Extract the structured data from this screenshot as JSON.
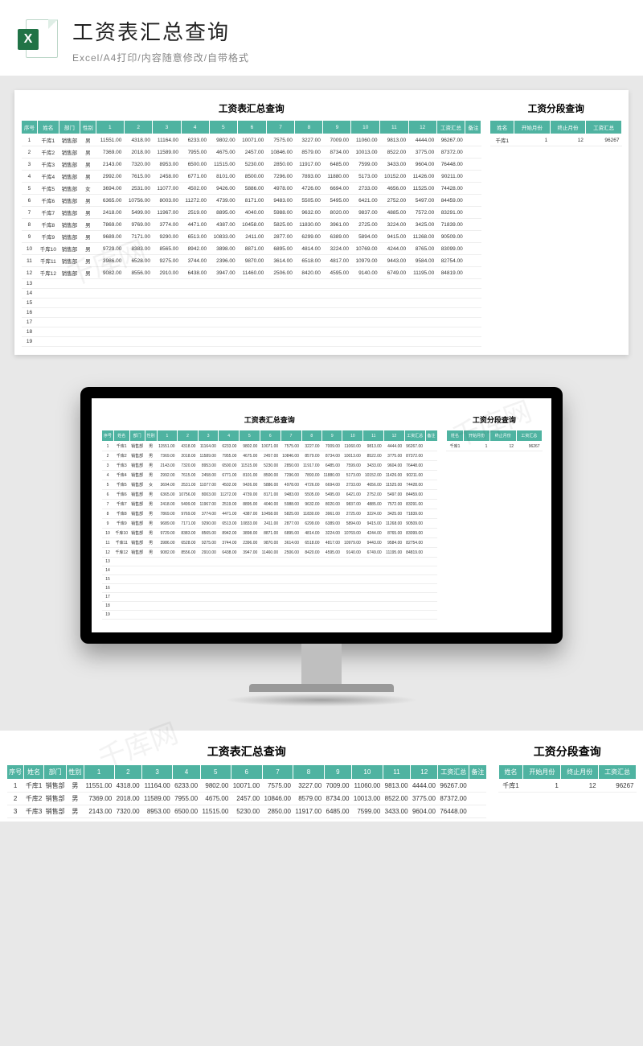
{
  "header": {
    "title": "工资表汇总查询",
    "subtitle": "Excel/A4打印/内容随意修改/自带格式",
    "icon_label": "X"
  },
  "main_table": {
    "title": "工资表汇总查询",
    "headers": [
      "序号",
      "姓名",
      "部门",
      "性别",
      "1",
      "2",
      "3",
      "4",
      "5",
      "6",
      "7",
      "8",
      "9",
      "10",
      "11",
      "12",
      "工资汇总",
      "备注"
    ],
    "rows": [
      [
        "1",
        "千库1",
        "销售部",
        "男",
        "11551.00",
        "4318.00",
        "11164.00",
        "6233.00",
        "9802.00",
        "10071.00",
        "7575.00",
        "3227.00",
        "7009.00",
        "11060.00",
        "9813.00",
        "4444.00",
        "96267.00",
        ""
      ],
      [
        "2",
        "千库2",
        "销售部",
        "男",
        "7369.00",
        "2018.00",
        "11589.00",
        "7955.00",
        "4675.00",
        "2457.00",
        "10846.00",
        "8579.00",
        "8734.00",
        "10013.00",
        "8522.00",
        "3775.00",
        "87372.00",
        ""
      ],
      [
        "3",
        "千库3",
        "销售部",
        "男",
        "2143.00",
        "7320.00",
        "8953.00",
        "6500.00",
        "11515.00",
        "5230.00",
        "2850.00",
        "11917.00",
        "6485.00",
        "7599.00",
        "3433.00",
        "9604.00",
        "76448.00",
        ""
      ],
      [
        "4",
        "千库4",
        "销售部",
        "男",
        "2992.00",
        "7615.00",
        "2458.00",
        "6771.00",
        "8101.00",
        "8500.00",
        "7296.00",
        "7893.00",
        "11880.00",
        "5173.00",
        "10152.00",
        "11426.00",
        "90211.00",
        ""
      ],
      [
        "5",
        "千库5",
        "销售部",
        "女",
        "3694.00",
        "2531.00",
        "11077.00",
        "4502.00",
        "9426.00",
        "5886.00",
        "4978.00",
        "4726.00",
        "6694.00",
        "2733.00",
        "4656.00",
        "11525.00",
        "74428.00",
        ""
      ],
      [
        "6",
        "千库6",
        "销售部",
        "男",
        "6365.00",
        "10756.00",
        "8003.00",
        "11272.00",
        "4739.00",
        "8171.00",
        "9483.00",
        "5505.00",
        "5495.00",
        "6421.00",
        "2752.00",
        "5497.00",
        "84459.00",
        ""
      ],
      [
        "7",
        "千库7",
        "销售部",
        "男",
        "2418.00",
        "5499.00",
        "11967.00",
        "2519.00",
        "8895.00",
        "4040.00",
        "5988.00",
        "9632.00",
        "8020.00",
        "9837.00",
        "4885.00",
        "7572.00",
        "83291.00",
        ""
      ],
      [
        "8",
        "千库8",
        "销售部",
        "男",
        "7869.00",
        "9769.00",
        "3774.00",
        "4471.00",
        "4387.00",
        "10458.00",
        "5825.00",
        "11830.00",
        "3961.00",
        "2725.00",
        "3224.00",
        "3425.00",
        "71839.00",
        ""
      ],
      [
        "9",
        "千库9",
        "销售部",
        "男",
        "9689.00",
        "7171.00",
        "9290.00",
        "6513.00",
        "10833.00",
        "2411.00",
        "2877.00",
        "6299.00",
        "6389.00",
        "5894.00",
        "9415.00",
        "11268.00",
        "90509.00",
        ""
      ],
      [
        "10",
        "千库10",
        "销售部",
        "男",
        "9729.00",
        "8383.00",
        "8565.00",
        "8942.00",
        "3898.00",
        "8871.00",
        "6895.00",
        "4814.00",
        "3224.00",
        "10769.00",
        "4244.00",
        "8765.00",
        "83099.00",
        ""
      ],
      [
        "11",
        "千库11",
        "销售部",
        "男",
        "3986.00",
        "6528.00",
        "9275.00",
        "3744.00",
        "2396.00",
        "9870.00",
        "3614.00",
        "6518.00",
        "4817.00",
        "10979.00",
        "9443.00",
        "9584.00",
        "82754.00",
        ""
      ],
      [
        "12",
        "千库12",
        "销售部",
        "男",
        "9082.00",
        "8556.00",
        "2910.00",
        "6438.00",
        "3947.00",
        "11460.00",
        "2506.00",
        "8420.00",
        "4595.00",
        "9140.00",
        "6749.00",
        "11195.00",
        "84819.00",
        ""
      ]
    ],
    "empty_rows": [
      "13",
      "14",
      "15",
      "16",
      "17",
      "18",
      "19"
    ]
  },
  "side_table": {
    "title": "工资分段查询",
    "headers": [
      "姓名",
      "开始月份",
      "终止月份",
      "工资汇总"
    ],
    "row": [
      "千库1",
      "1",
      "12",
      "96267"
    ]
  },
  "strip": {
    "rows_shown": 3
  },
  "watermark": "千库网",
  "colors": {
    "accent": "#4fb3a1"
  }
}
